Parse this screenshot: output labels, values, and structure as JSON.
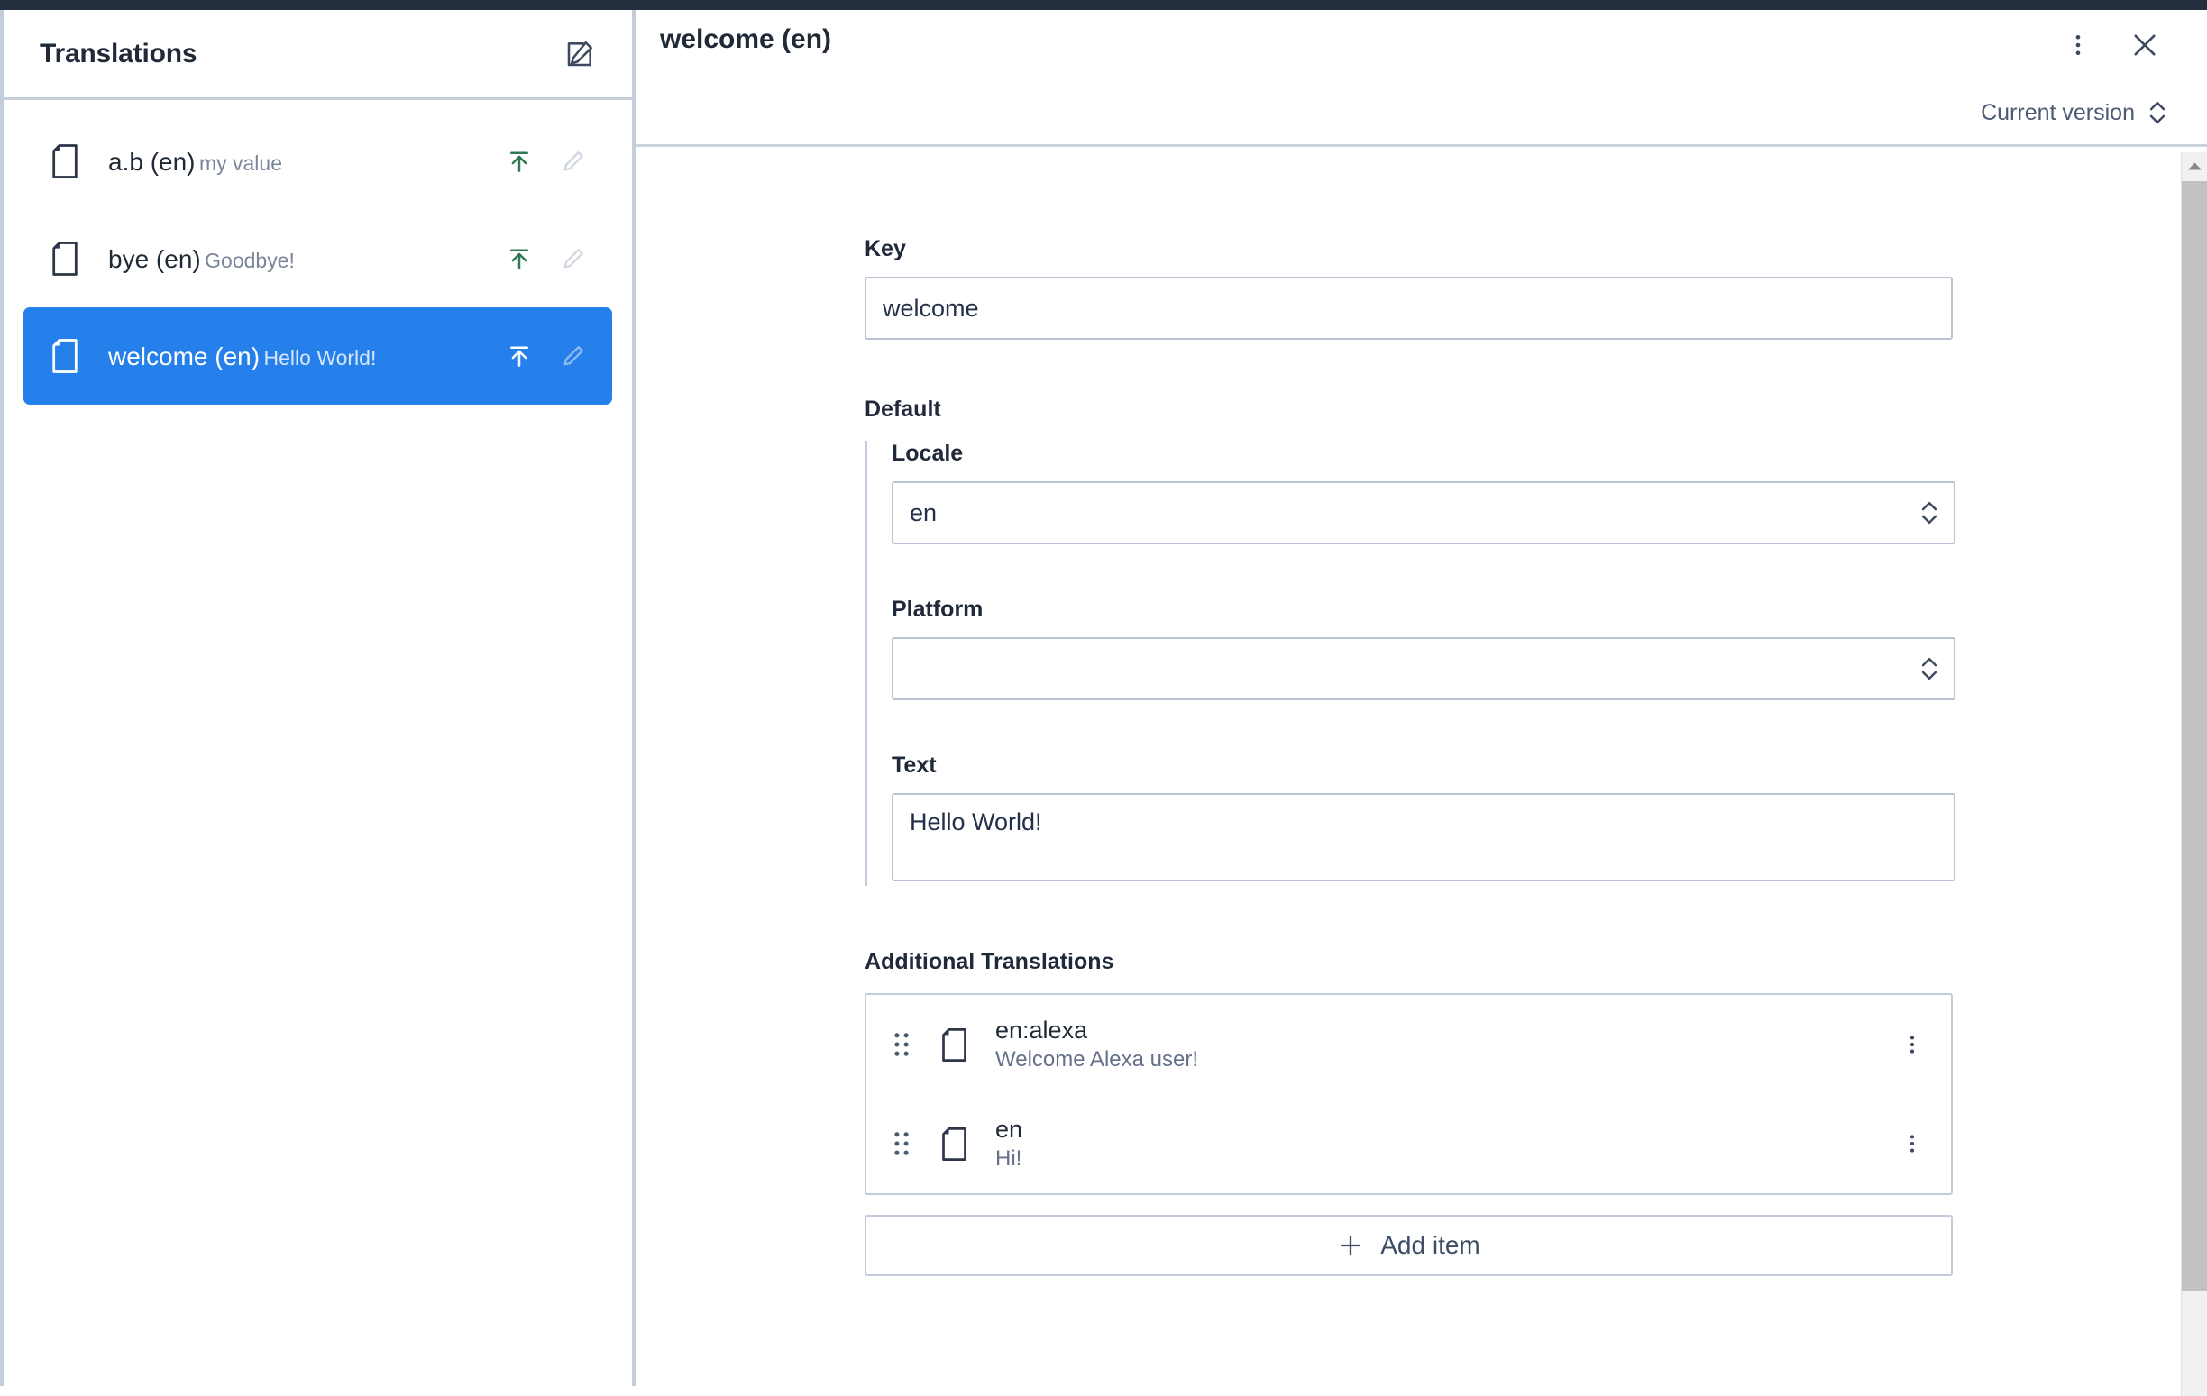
{
  "theme": {
    "topbar_color": "#232f3e",
    "accent_selected": "#2680eb",
    "publish_icon_color": "#2f7a52",
    "border_color": "#c3ccda",
    "text_primary": "#1f2a37",
    "text_muted": "#7b8699"
  },
  "sidebar": {
    "title": "Translations",
    "compose_icon": "compose-pencil-square-icon",
    "items": [
      {
        "icon": "document-icon",
        "name": "a.b (en)",
        "value": "my value",
        "publish_icon": "publish-upload-icon",
        "edit_icon": "pencil-icon",
        "selected": false
      },
      {
        "icon": "document-icon",
        "name": "bye (en)",
        "value": "Goodbye!",
        "publish_icon": "publish-upload-icon",
        "edit_icon": "pencil-icon",
        "selected": false
      },
      {
        "icon": "document-icon",
        "name": "welcome (en)",
        "value": "Hello World!",
        "publish_icon": "publish-upload-icon",
        "edit_icon": "pencil-icon",
        "selected": true
      }
    ]
  },
  "main": {
    "title": "welcome (en)",
    "kebab_icon": "more-vertical-icon",
    "close_icon": "close-icon",
    "version": {
      "label": "Current version",
      "chevrons_icon": "chevron-up-down-icon"
    },
    "form": {
      "key": {
        "label": "Key",
        "value": "welcome",
        "placeholder": ""
      },
      "default": {
        "label": "Default",
        "locale": {
          "label": "Locale",
          "value": "en",
          "placeholder": ""
        },
        "platform": {
          "label": "Platform",
          "value": "",
          "placeholder": ""
        },
        "text": {
          "label": "Text",
          "value": "Hello World!",
          "placeholder": ""
        }
      },
      "additional": {
        "label": "Additional Translations",
        "rows": [
          {
            "drag_icon": "drag-handle-icon",
            "doc_icon": "document-icon",
            "locale": "en:alexa",
            "value": "Welcome Alexa user!",
            "kebab_icon": "more-vertical-icon"
          },
          {
            "drag_icon": "drag-handle-icon",
            "doc_icon": "document-icon",
            "locale": "en",
            "value": "Hi!",
            "kebab_icon": "more-vertical-icon"
          }
        ],
        "add_button": {
          "label": "Add item",
          "icon": "plus-icon"
        }
      }
    }
  },
  "scrollbar": {
    "up_arrow_icon": "scroll-up-arrow-icon"
  }
}
